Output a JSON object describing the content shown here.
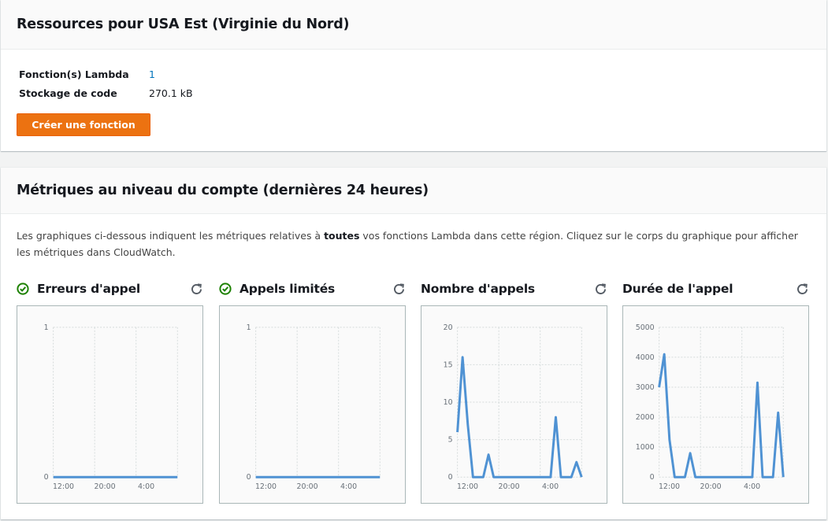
{
  "resources": {
    "title": "Ressources pour USA Est (Virginie du Nord)",
    "rows": [
      {
        "key": "Fonction(s) Lambda",
        "value": "1",
        "link": true
      },
      {
        "key": "Stockage de code",
        "value": "270.1 kB",
        "link": false
      }
    ],
    "create_button": "Créer une fonction"
  },
  "metrics": {
    "title": "Métriques au niveau du compte (dernières 24 heures)",
    "description_before": "Les graphiques ci-dessous indiquent les métriques relatives à ",
    "description_bold": "toutes",
    "description_after": " vos fonctions Lambda dans cette région. Cliquez sur le corps du graphique pour afficher les métriques dans CloudWatch.",
    "icons": {
      "status": "check-circle-icon",
      "refresh": "refresh-icon"
    },
    "colors": {
      "line": "#4f92d3",
      "ok": "#1d8102",
      "button": "#ec7211",
      "link": "#0073bb"
    }
  },
  "chart_data": [
    {
      "type": "line",
      "title": "Erreurs d'appel",
      "status": "ok",
      "x_ticks": [
        "12:00",
        "20:00",
        "4:00"
      ],
      "y_ticks": [
        "0",
        "1"
      ],
      "ylim": [
        0,
        1
      ],
      "grid": true,
      "series": [
        {
          "values": [
            0,
            0,
            0,
            0,
            0,
            0,
            0,
            0,
            0,
            0,
            0,
            0,
            0,
            0,
            0,
            0,
            0,
            0,
            0,
            0,
            0,
            0,
            0,
            0,
            0
          ]
        }
      ]
    },
    {
      "type": "line",
      "title": "Appels limités",
      "status": "ok",
      "x_ticks": [
        "12:00",
        "20:00",
        "4:00"
      ],
      "y_ticks": [
        "0",
        "1"
      ],
      "ylim": [
        0,
        1
      ],
      "grid": true,
      "series": [
        {
          "values": [
            0,
            0,
            0,
            0,
            0,
            0,
            0,
            0,
            0,
            0,
            0,
            0,
            0,
            0,
            0,
            0,
            0,
            0,
            0,
            0,
            0,
            0,
            0,
            0,
            0
          ]
        }
      ]
    },
    {
      "type": "line",
      "title": "Nombre d'appels",
      "status": "none",
      "x_ticks": [
        "12:00",
        "20:00",
        "4:00"
      ],
      "y_ticks": [
        "0",
        "5",
        "10",
        "15",
        "20"
      ],
      "ylim": [
        0,
        20
      ],
      "grid": true,
      "series": [
        {
          "values": [
            6,
            16,
            7,
            0,
            0,
            0,
            3,
            0,
            0,
            0,
            0,
            0,
            0,
            0,
            0,
            0,
            0,
            0,
            0,
            8,
            0,
            0,
            0,
            2,
            0
          ]
        }
      ]
    },
    {
      "type": "line",
      "title": "Durée de l'appel",
      "status": "none",
      "x_ticks": [
        "12:00",
        "20:00",
        "4:00"
      ],
      "y_ticks": [
        "0",
        "1000",
        "2000",
        "3000",
        "4000",
        "5000"
      ],
      "ylim": [
        0,
        5000
      ],
      "grid": true,
      "series": [
        {
          "values": [
            3000,
            4100,
            1250,
            0,
            0,
            0,
            800,
            0,
            0,
            0,
            0,
            0,
            0,
            0,
            0,
            0,
            0,
            0,
            0,
            3150,
            0,
            0,
            0,
            2150,
            0
          ]
        }
      ]
    }
  ]
}
